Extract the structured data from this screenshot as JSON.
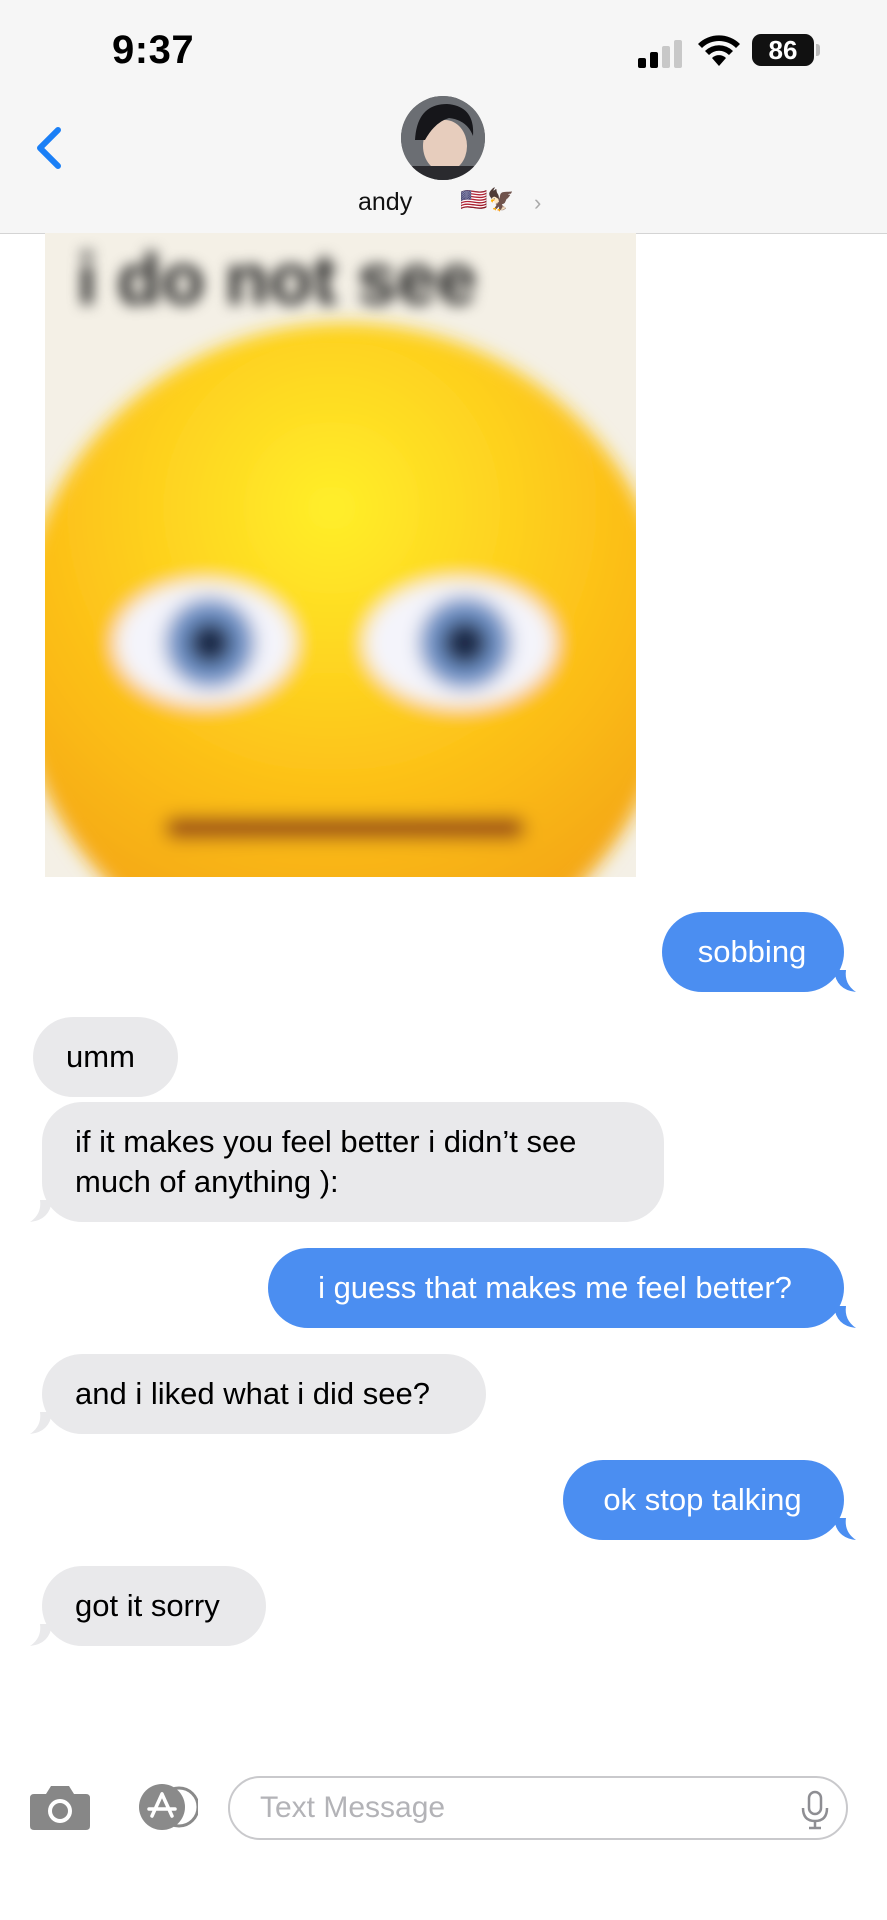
{
  "status_bar": {
    "time": "9:37",
    "battery": "86"
  },
  "header": {
    "contact_name": "andy",
    "contact_emoji": "🇺🇸🦅",
    "chevron": "›"
  },
  "image_message": {
    "caption": "i do not see"
  },
  "messages": [
    {
      "side": "outgoing",
      "text": "sobbing"
    },
    {
      "side": "incoming",
      "text": "umm"
    },
    {
      "side": "incoming",
      "text": "if it makes you feel better i didn’t see\nmuch of anything ):"
    },
    {
      "side": "outgoing",
      "text": "i guess that makes me feel better?"
    },
    {
      "side": "incoming",
      "text": "and i liked what i did see?"
    },
    {
      "side": "outgoing",
      "text": "ok stop talking"
    },
    {
      "side": "incoming",
      "text": "got it sorry"
    }
  ],
  "input": {
    "placeholder": "Text Message"
  },
  "colors": {
    "outgoing_bubble": "#4b8ef1",
    "incoming_bubble": "#e9e9eb",
    "accent": "#1a7ff6"
  }
}
